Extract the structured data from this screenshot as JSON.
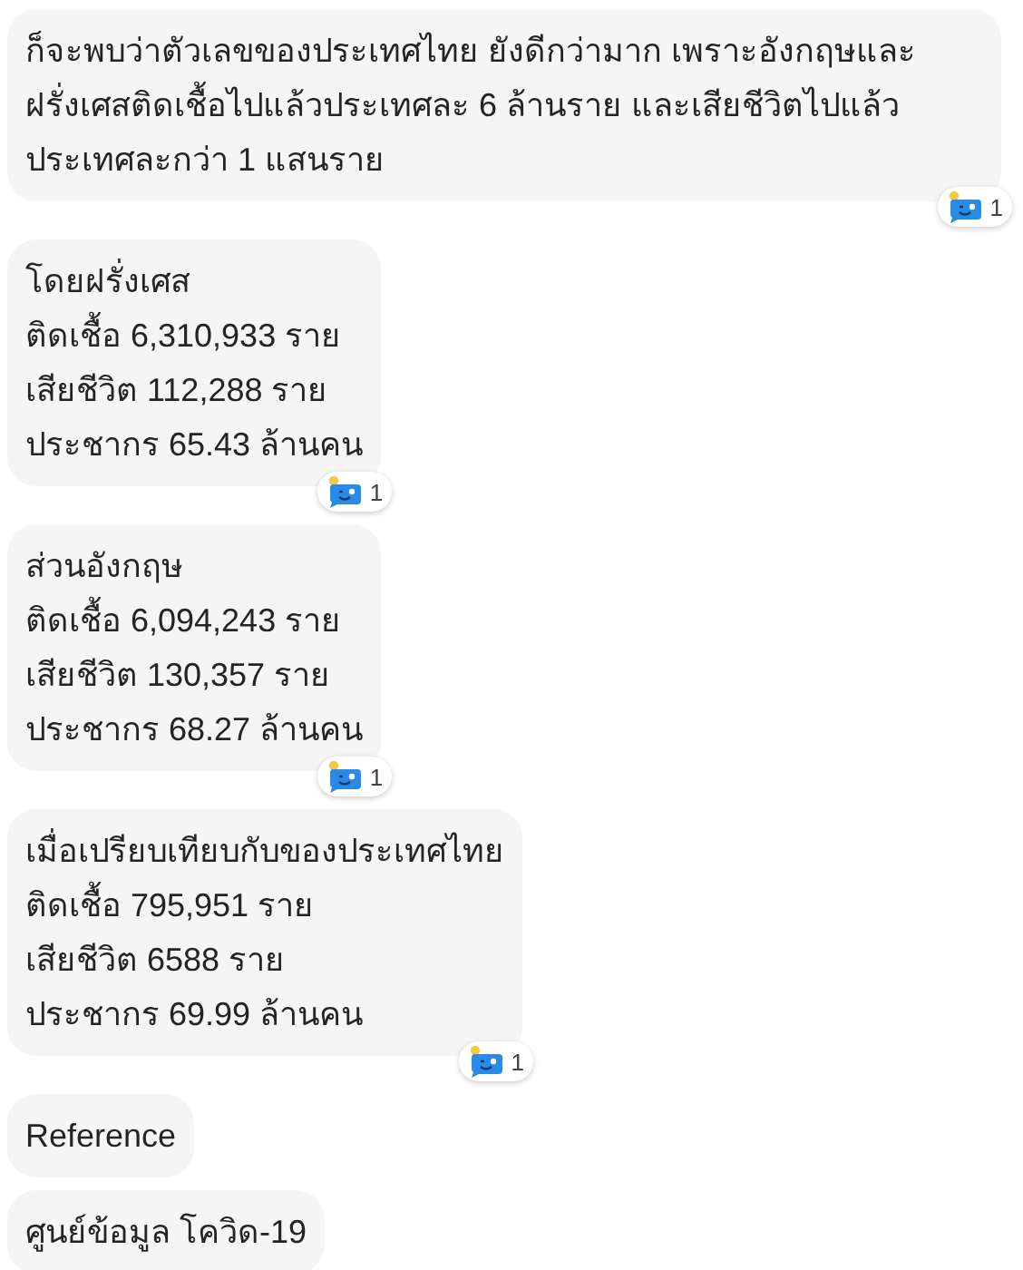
{
  "messages": [
    {
      "kind": "paragraph",
      "text": "ก็จะพบว่าตัวเลขของประเทศไทย ยังดีกว่ามาก เพราะอังกฤษและฝรั่งเศสติดเชื้อไปแล้วประเทศละ 6 ล้านราย และเสียชีวิตไปแล้วประเทศละกว่า 1 แสนราย",
      "reaction": {
        "count": "1"
      }
    },
    {
      "kind": "lines",
      "lines": [
        "โดยฝรั่งเศส",
        "ติดเชื้อ 6,310,933 ราย",
        "เสียชีวิต 112,288 ราย",
        "ประชากร 65.43 ล้านคน"
      ],
      "reaction": {
        "count": "1"
      }
    },
    {
      "kind": "lines",
      "lines": [
        "ส่วนอังกฤษ",
        "ติดเชื้อ 6,094,243 ราย",
        "เสียชีวิต 130,357 ราย",
        "ประชากร 68.27 ล้านคน"
      ],
      "reaction": {
        "count": "1"
      }
    },
    {
      "kind": "lines",
      "lines": [
        "เมื่อเปรียบเทียบกับของประเทศไทย",
        "ติดเชื้อ 795,951 ราย",
        "เสียชีวิต 6588 ราย",
        "ประชากร 69.99 ล้านคน"
      ],
      "reaction": {
        "count": "1"
      }
    },
    {
      "kind": "paragraph",
      "text": "Reference"
    },
    {
      "kind": "paragraph",
      "text": "ศูนย์ข้อมูล โควิด-19"
    }
  ]
}
